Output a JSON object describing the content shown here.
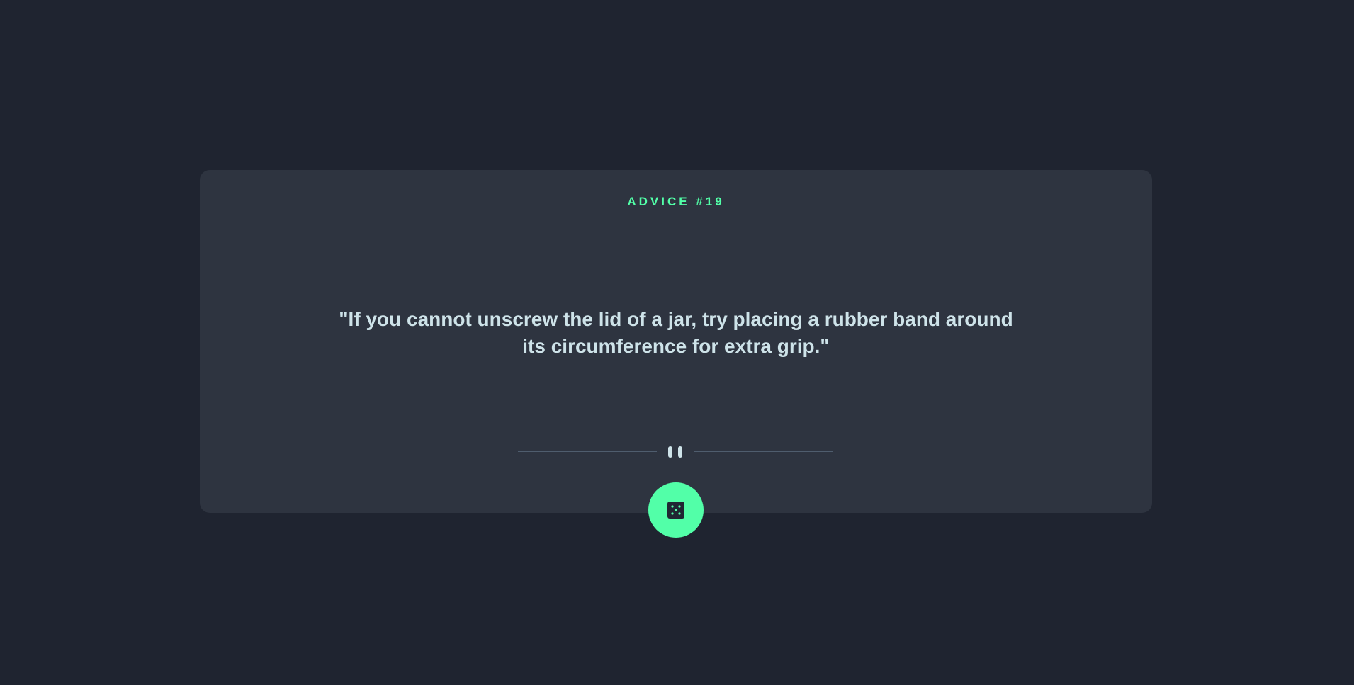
{
  "advice": {
    "title": "ADVICE #19",
    "quote": "\"If you cannot unscrew the lid of a jar, try placing a rubber band around its circumference for extra grip.\""
  },
  "icons": {
    "divider": "pause-icon",
    "button": "dice-icon"
  },
  "colors": {
    "background": "#1f2430",
    "card": "#2e3440",
    "accent": "#52ffa8",
    "text": "#cee3e9",
    "divider": "#4f5d6e"
  }
}
